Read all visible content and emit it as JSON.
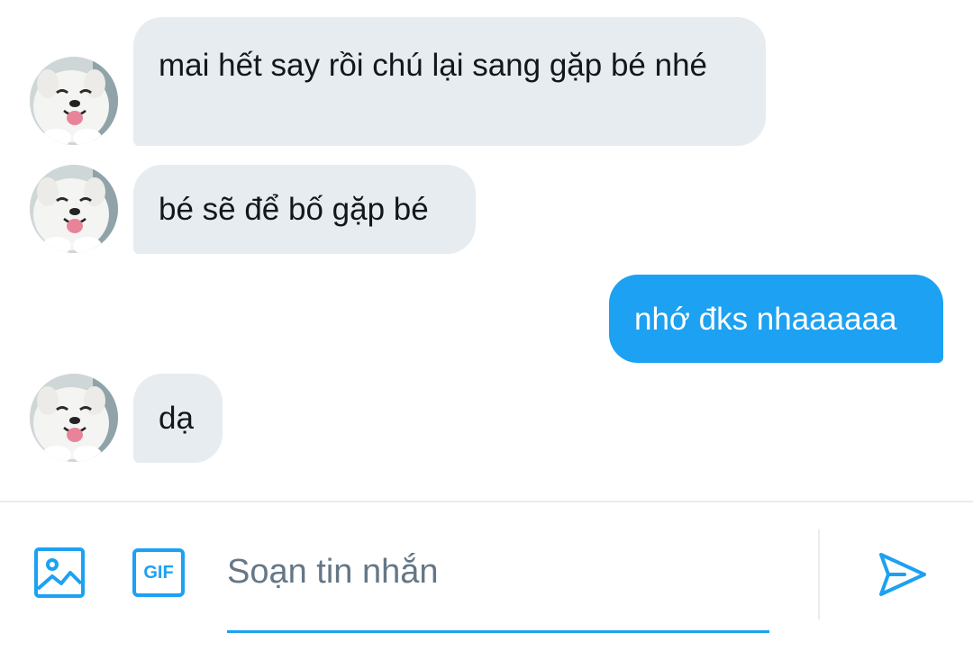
{
  "colors": {
    "accent": "#1da1f2",
    "bubble_received": "#e6ecf0",
    "placeholder": "#657786"
  },
  "conversation": {
    "messages": [
      {
        "sender": "them",
        "text": "mai hết say rồi chú lại sang gặp bé nhé",
        "avatar_icon": "samoyed-dog-avatar"
      },
      {
        "sender": "them",
        "text": "bé sẽ để bố gặp bé",
        "avatar_icon": "samoyed-dog-avatar"
      },
      {
        "sender": "me",
        "text": "nhớ đks nhaaaaaa"
      },
      {
        "sender": "them",
        "text": "dạ",
        "avatar_icon": "samoyed-dog-avatar"
      }
    ]
  },
  "composer": {
    "placeholder": "Soạn tin nhắn",
    "value": "",
    "gif_label": "GIF",
    "media_icon": "image-icon",
    "send_icon": "send-icon"
  }
}
